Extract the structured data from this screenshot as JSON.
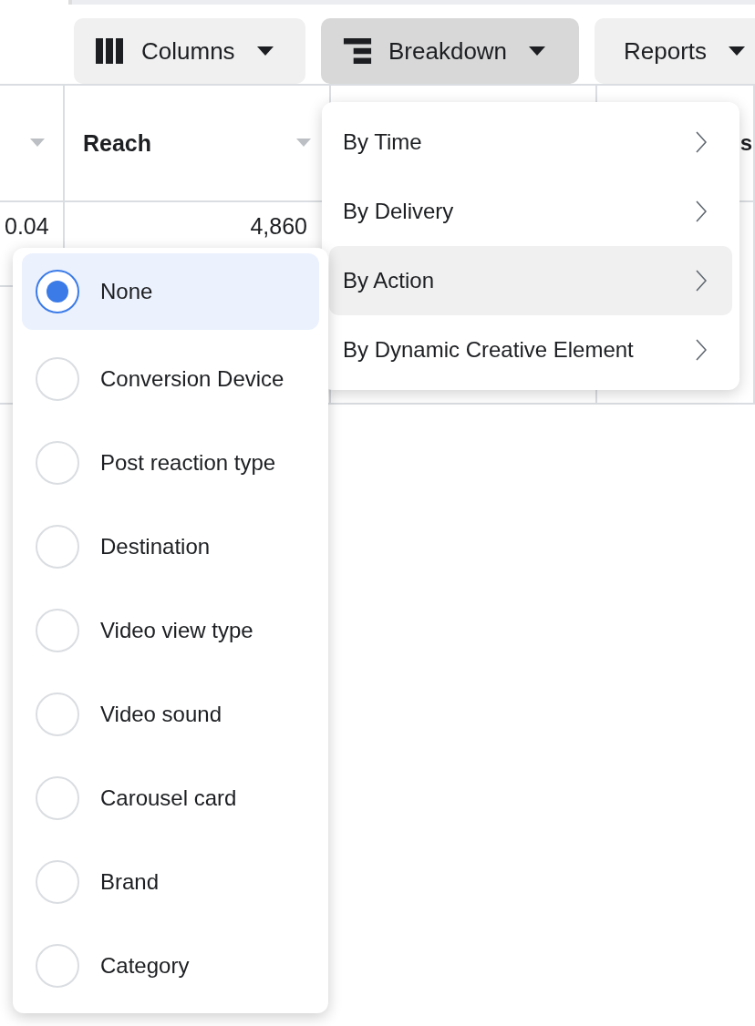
{
  "toolbar": [
    {
      "label": "Columns",
      "selected": false
    },
    {
      "label": "Breakdown",
      "selected": true
    },
    {
      "label": "Reports",
      "selected": false
    }
  ],
  "table": {
    "columns": [
      {
        "menu_caret": true,
        "rows": [
          {
            "value": "0.04"
          }
        ]
      },
      {
        "header": "Reach",
        "menu_caret": true,
        "rows": [
          {
            "value": "4,860"
          }
        ]
      },
      {
        "header": "s"
      }
    ]
  },
  "breakdown_menu": [
    {
      "label": "By Time",
      "selected": false
    },
    {
      "label": "By Delivery",
      "selected": false
    },
    {
      "label": "By Action",
      "selected": true
    },
    {
      "label": "By Dynamic Creative Element",
      "selected": false
    }
  ],
  "action_submenu": [
    {
      "label": "None",
      "selected": true
    },
    {
      "label": "Conversion Device",
      "selected": false
    },
    {
      "label": "Post reaction type",
      "selected": false
    },
    {
      "label": "Destination",
      "selected": false
    },
    {
      "label": "Video view type",
      "selected": false
    },
    {
      "label": "Video sound",
      "selected": false
    },
    {
      "label": "Carousel card",
      "selected": false
    },
    {
      "label": "Brand",
      "selected": false
    },
    {
      "label": "Category",
      "selected": false
    }
  ]
}
